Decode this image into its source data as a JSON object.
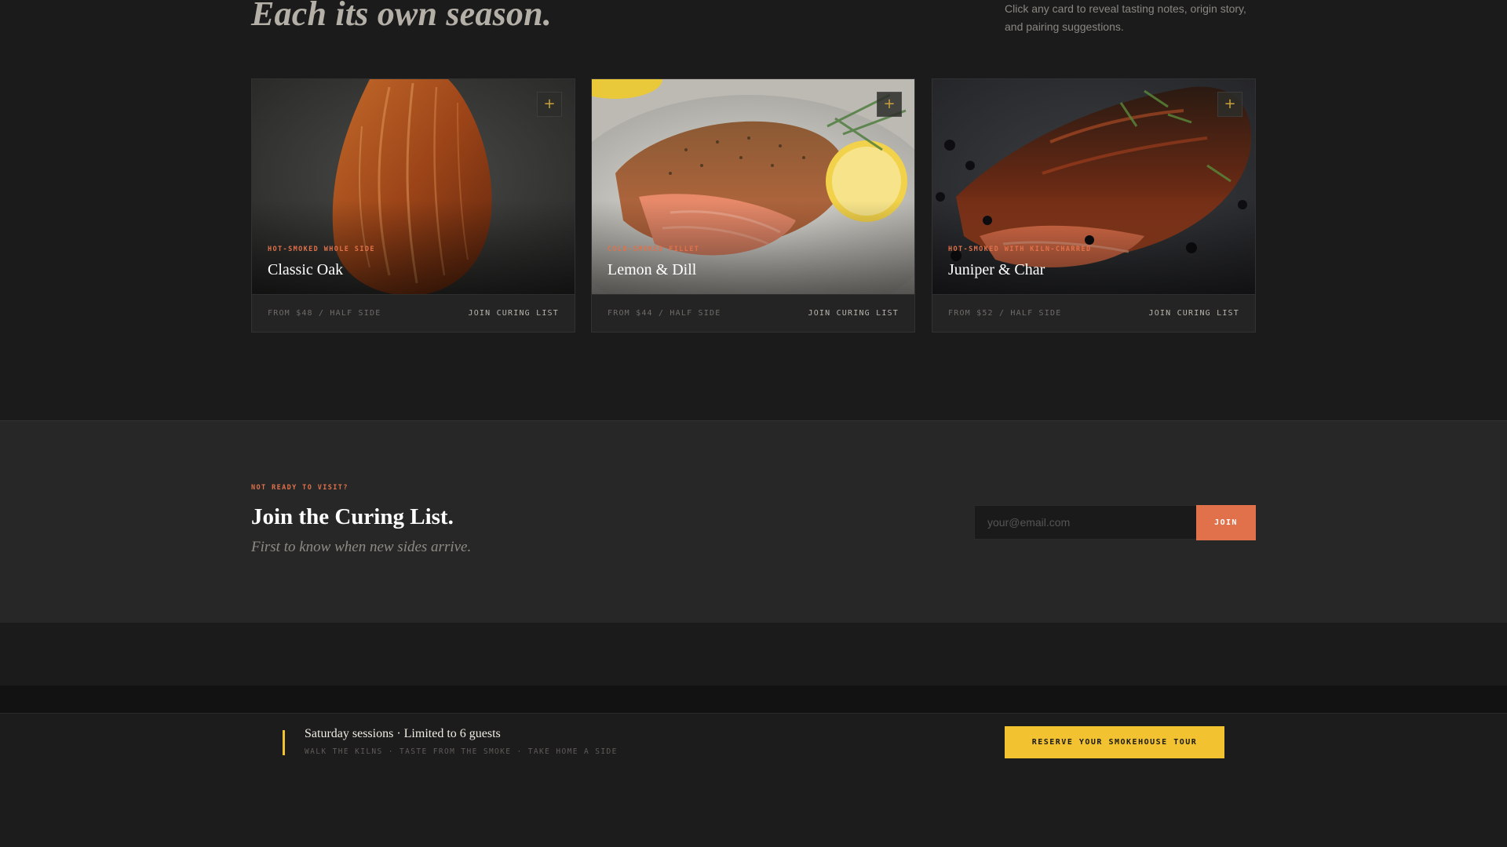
{
  "header": {
    "title": "Each its own season.",
    "hint": "Click any card to reveal tasting notes, origin story, and pairing suggestions."
  },
  "cards": [
    {
      "eyebrow": "HOT-SMOKED WHOLE SIDE",
      "name": "Classic Oak",
      "price": "FROM $48 / HALF SIDE",
      "cta": "JOIN CURING LIST",
      "expand_icon": "plus-icon"
    },
    {
      "eyebrow": "COLD-SMOKED FILLET",
      "name": "Lemon & Dill",
      "price": "FROM $44 / HALF SIDE",
      "cta": "JOIN CURING LIST",
      "expand_icon": "plus-icon"
    },
    {
      "eyebrow": "HOT-SMOKED WITH KILN-CHARRED",
      "name": "Juniper & Char",
      "price": "FROM $52 / HALF SIDE",
      "cta": "JOIN CURING LIST",
      "expand_icon": "plus-icon"
    }
  ],
  "curing": {
    "eyebrow": "NOT READY TO VISIT?",
    "title": "Join the Curing List.",
    "subtitle": "First to know when new sides arrive.",
    "email_placeholder": "your@email.com",
    "email_value": "",
    "join_label": "JOIN"
  },
  "tour": {
    "title": "Saturday sessions · Limited to 6 guests",
    "subtitle": "WALK THE KILNS · TASTE FROM THE SMOKE · TAKE HOME A SIDE",
    "button_label": "RESERVE YOUR SMOKEHOUSE TOUR"
  },
  "colors": {
    "accent": "#e0714a",
    "highlight": "#f2c230",
    "background": "#1a1a1a"
  }
}
